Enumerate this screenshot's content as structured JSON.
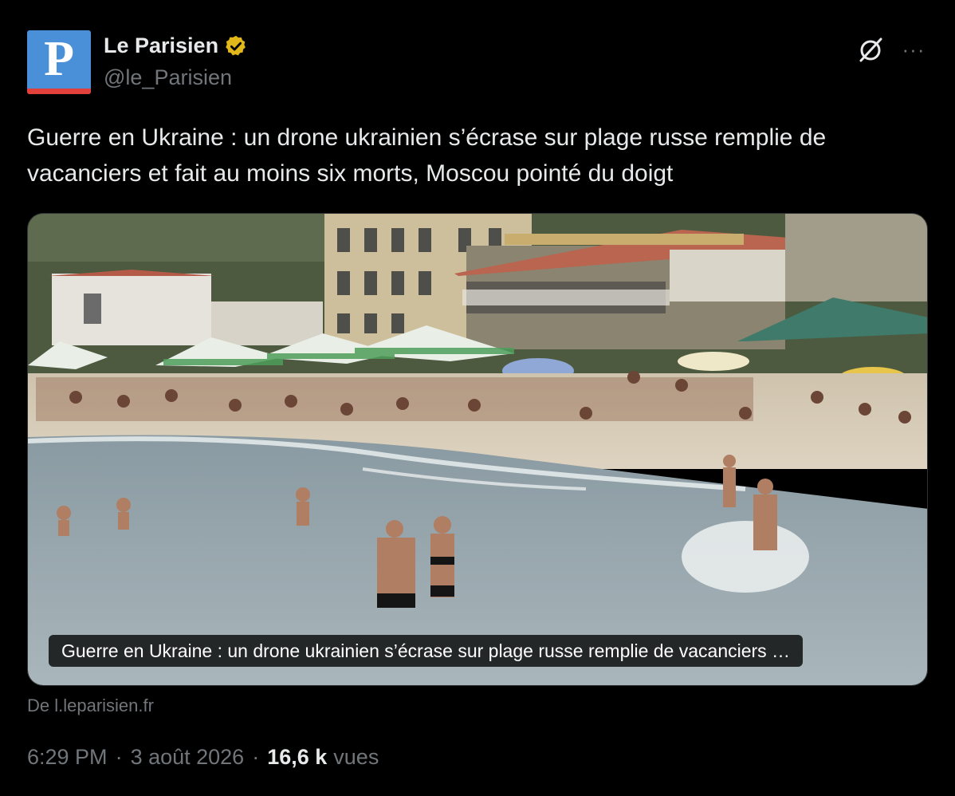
{
  "author": {
    "avatar_letter": "P",
    "display_name": "Le Parisien",
    "handle": "@le_Parisien",
    "verified_color": "#e2b719"
  },
  "header_actions": {
    "grok_icon": "grok-slash-circle-icon",
    "more_icon": "more-horizontal-icon",
    "more_label": "···"
  },
  "tweet": {
    "text": "Guerre en Ukraine : un drone ukrainien s’écrase sur plage russe remplie de vacanciers et fait au moins six morts, Moscou pointé du doigt"
  },
  "link_card": {
    "image_description_icon": "beach-photo",
    "caption": "Guerre en Ukraine : un drone ukrainien s’écrase sur plage russe remplie de vacanciers …",
    "source": "De l.leparisien.fr"
  },
  "meta": {
    "time": "6:29 PM",
    "separator": "·",
    "date": "3 août 2026",
    "views_count": "16,6 k",
    "views_label": "vues"
  },
  "colors": {
    "background": "#000000",
    "text_primary": "#e7e9ea",
    "text_secondary": "#71767b",
    "avatar_blue": "#4a90d9",
    "avatar_red": "#e2403a"
  }
}
